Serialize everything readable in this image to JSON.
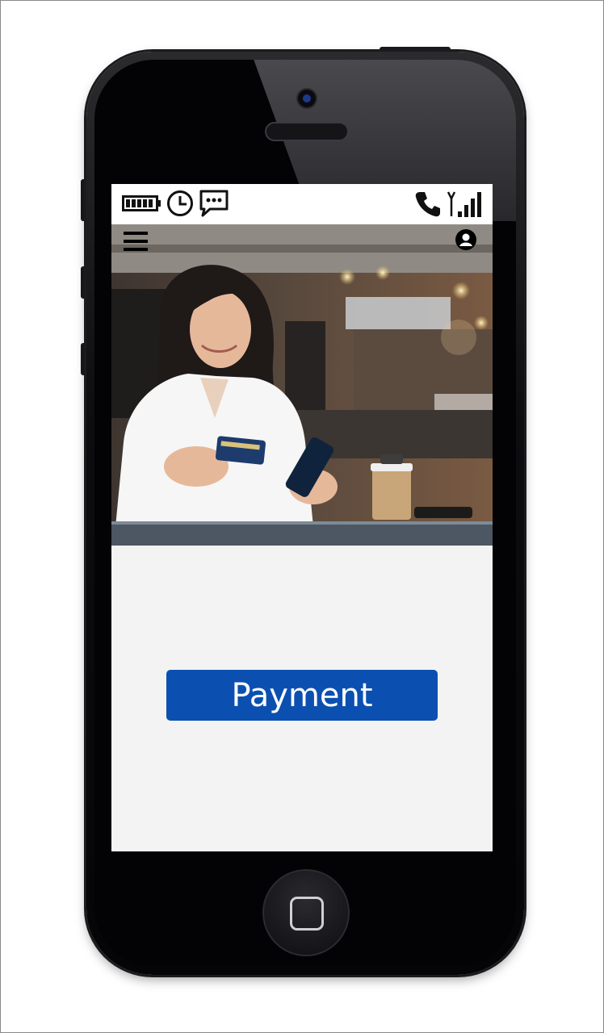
{
  "device": {
    "frame": "smartphone"
  },
  "status_bar": {
    "left_icons": [
      "battery-icon",
      "clock-icon",
      "message-icon"
    ],
    "right_icons": [
      "phone-icon",
      "signal-icon"
    ]
  },
  "nav": {
    "menu_icon": "hamburger-menu-icon",
    "profile_icon": "user-profile-icon"
  },
  "hero": {
    "image": "woman-paying-with-card-and-phone-in-cafe"
  },
  "payment_button": {
    "label": "Payment",
    "color": "#0b50b1"
  }
}
